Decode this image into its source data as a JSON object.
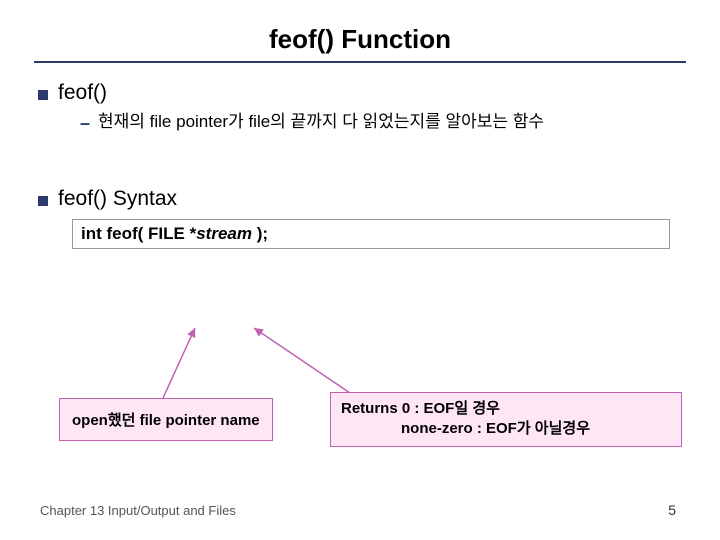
{
  "title": "feof() Function",
  "section1": {
    "heading": "feof()",
    "desc": "현재의 file pointer가 file의 끝까지 다 읽었는지를 알아보는 함수"
  },
  "section2": {
    "heading": "feof() Syntax",
    "code_pre": "int feof( FILE *",
    "code_em": "stream",
    "code_post": " );"
  },
  "annot_left": "open했던 file pointer name",
  "annot_right": {
    "line1": "Returns  0              : EOF일 경우",
    "line2": "none-zero : EOF가 아닐경우"
  },
  "footer": "Chapter 13  Input/Output and Files",
  "page": "5"
}
